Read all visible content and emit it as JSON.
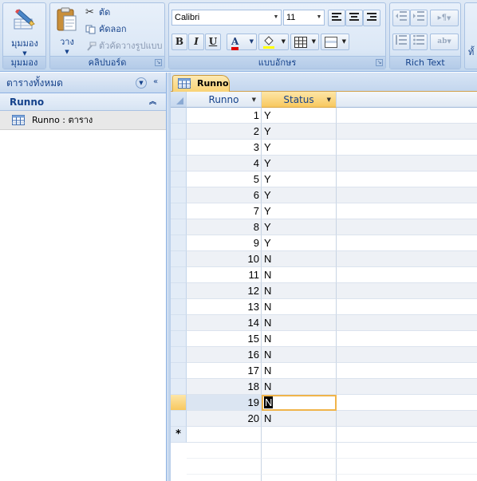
{
  "ribbon": {
    "view": {
      "button_label": "มุมมอง",
      "group_label": "มุมมอง"
    },
    "clipboard": {
      "paste_label": "วาง",
      "cut_label": "ตัด",
      "copy_label": "คัดลอก",
      "format_painter_label": "ตัวคัดวางรูปแบบ",
      "group_label": "คลิปบอร์ด"
    },
    "font": {
      "font_name": "Calibri",
      "font_size": "11",
      "bold_label": "B",
      "italic_label": "I",
      "underline_label": "U",
      "font_color_label": "A",
      "group_label": "แบบอักษร"
    },
    "rich_text": {
      "group_label": "Rich Text"
    },
    "partial_label": "ทั้"
  },
  "nav": {
    "header": "ตารางทั้งหมด",
    "group": "Runno",
    "item_name": "Runno",
    "item_type": "ตาราง",
    "item_sep": " : "
  },
  "doc": {
    "tab_label": "Runno"
  },
  "table": {
    "columns": [
      "Runno",
      "Status"
    ],
    "rows": [
      [
        "1",
        "Y"
      ],
      [
        "2",
        "Y"
      ],
      [
        "3",
        "Y"
      ],
      [
        "4",
        "Y"
      ],
      [
        "5",
        "Y"
      ],
      [
        "6",
        "Y"
      ],
      [
        "7",
        "Y"
      ],
      [
        "8",
        "Y"
      ],
      [
        "9",
        "Y"
      ],
      [
        "10",
        "N"
      ],
      [
        "11",
        "N"
      ],
      [
        "12",
        "N"
      ],
      [
        "13",
        "N"
      ],
      [
        "14",
        "N"
      ],
      [
        "15",
        "N"
      ],
      [
        "16",
        "N"
      ],
      [
        "17",
        "N"
      ],
      [
        "18",
        "N"
      ],
      [
        "19",
        "N"
      ],
      [
        "20",
        "N"
      ]
    ],
    "current_row_index": 18,
    "new_row_marker": "*"
  },
  "colors": {
    "ribbon_bg": "#d3e1f2",
    "accent_orange": "#f8c85e",
    "text_blue": "#15428b",
    "font_color_swatch": "#e00000",
    "highlight_swatch": "#ffff00"
  }
}
